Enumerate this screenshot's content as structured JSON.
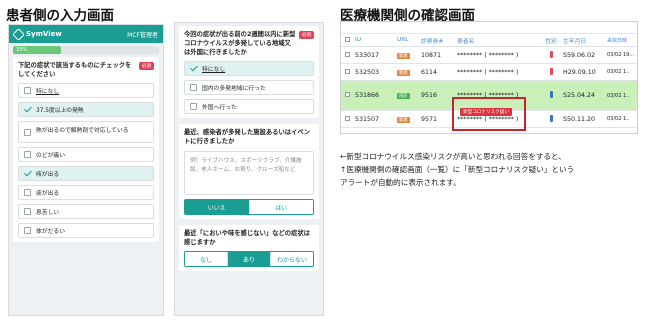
{
  "headings": {
    "left": "患者側の入力画面",
    "right": "医療機関側の確認画面"
  },
  "phone1": {
    "app_name": "SymView",
    "header_right": "MCF管理者",
    "progress_label": "33%",
    "progress_value": 33,
    "question": "下記の症状で該当するものにチェックをしてください",
    "required": "必須",
    "options": [
      {
        "label": "特になし",
        "checked": false
      },
      {
        "label": "37.5度以上の発熱",
        "checked": true
      },
      {
        "label": "熱が出るので解熱剤で対応している",
        "checked": false
      },
      {
        "label": "のどが痛い",
        "checked": false
      },
      {
        "label": "咳が出る",
        "checked": true
      },
      {
        "label": "痰が出る",
        "checked": false
      },
      {
        "label": "息苦しい",
        "checked": false
      },
      {
        "label": "体がだるい",
        "checked": false
      }
    ]
  },
  "phone2": {
    "q1": {
      "text": "今回の症状が出る前の2週間以内に新型コロナウイルスが多発している地域又は外国に行きましたか",
      "required": "必須",
      "options": [
        {
          "label": "特になし",
          "checked": true
        },
        {
          "label": "国内の多発地域に行った",
          "checked": false
        },
        {
          "label": "外国へ行った",
          "checked": false
        }
      ]
    },
    "q2": {
      "text": "最近、感染者が多発した施設あるいはイベントに行きましたか",
      "placeholder": "例）ライブハウス、スポーツクラブ、介護施設、老人ホーム、お祭り、クルーズ船など",
      "no": "いいえ",
      "yes": "はい"
    },
    "q3": {
      "text": "最近「においや味を感じない」などの症状は感じますか",
      "options": [
        "なし",
        "あり",
        "わからない"
      ]
    }
  },
  "table": {
    "headers": [
      "ID",
      "URL",
      "診察券#",
      "患者名",
      "性別",
      "生年月日",
      "来院日時"
    ],
    "rows": [
      {
        "id": "533017",
        "url": "新規",
        "card": "10871",
        "name": "******** ( ******** )",
        "sex": "female",
        "birth": "S59.06.02",
        "visit": "03/02 19:..",
        "alert": false
      },
      {
        "id": "532503",
        "url": "新規",
        "card": "6114",
        "name": "******** ( ******** )",
        "sex": "female",
        "birth": "H29.09.10",
        "visit": "03/02 1..",
        "alert": false
      },
      {
        "id": "531866",
        "url": "再診",
        "card": "9516",
        "name": "******** ( ******** )",
        "sex": "male",
        "birth": "S25.04.24",
        "visit": "03/02 1..",
        "alert": true
      },
      {
        "id": "531507",
        "url": "新規",
        "card": "9571",
        "name": "******** ( ******** )",
        "sex": "male",
        "birth": "S50.11.20",
        "visit": "03/02 1..",
        "alert": false
      }
    ],
    "alert_label": "新型コロナリスク疑い"
  },
  "caption": {
    "line1": "←新型コロナウイルス感染リスクが高いと思われる回答をすると、",
    "line2": "↑医療機関側の確認画面（一覧）に「新型コロナリスク疑い」という",
    "line3": "アラートが自動的に表示されます。"
  }
}
